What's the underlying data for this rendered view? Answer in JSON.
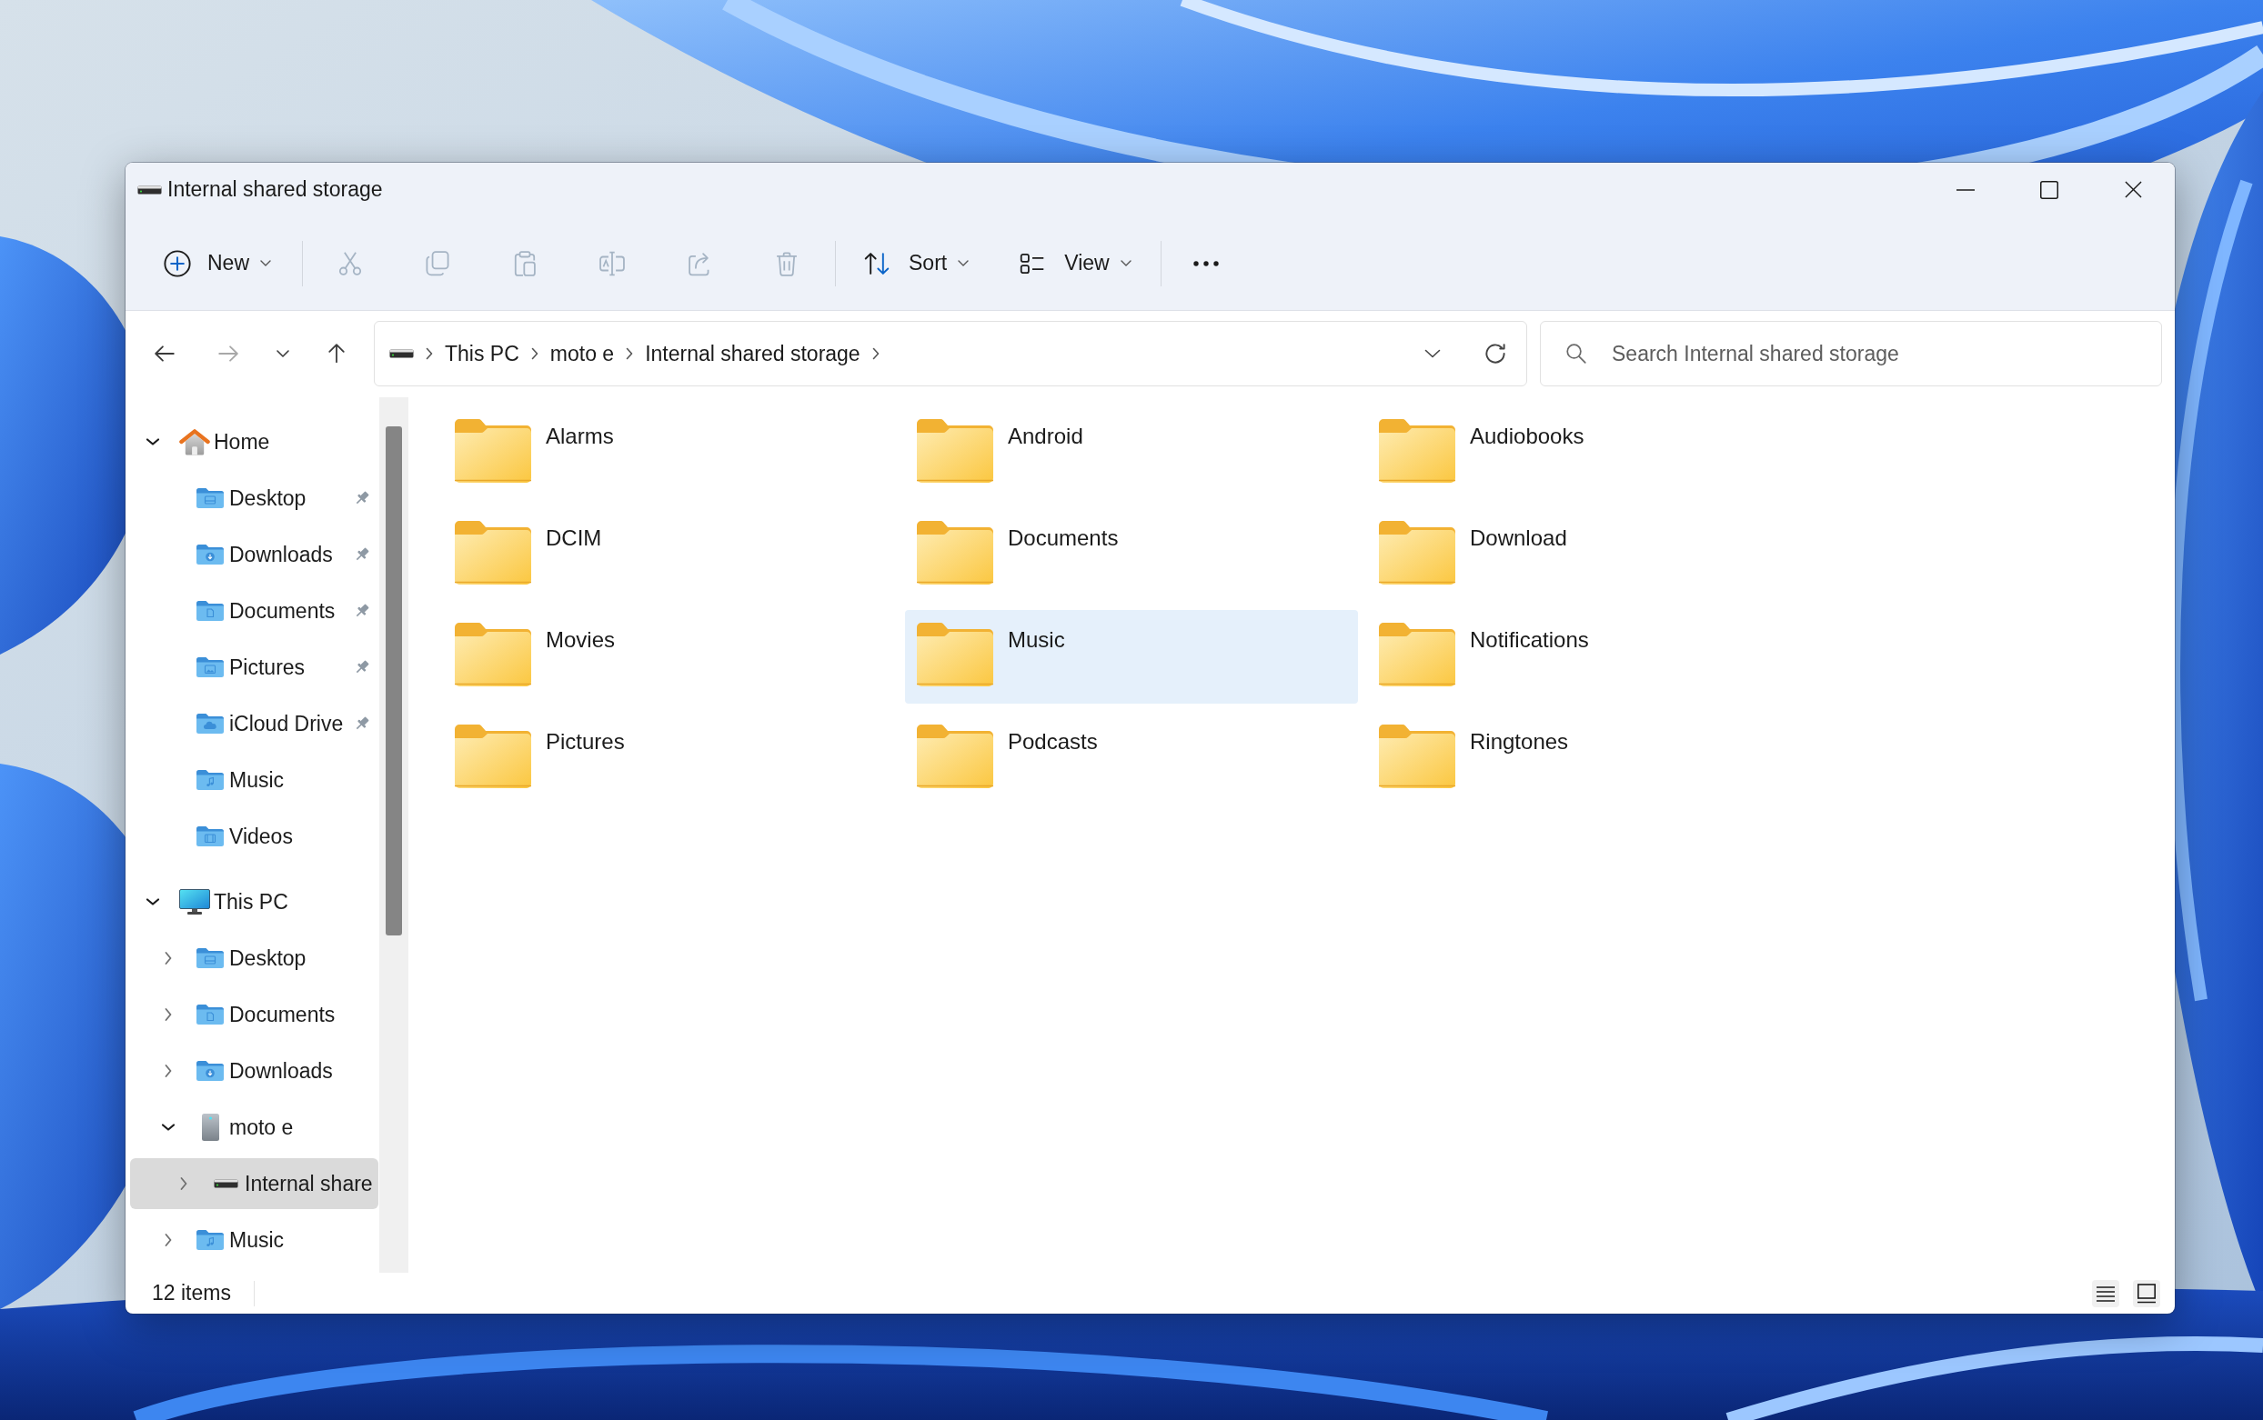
{
  "window": {
    "title": "Internal shared storage"
  },
  "toolbar": {
    "new": {
      "label": "New"
    },
    "actions": [
      {
        "disabled": true
      },
      {
        "disabled": true
      },
      {
        "disabled": true
      },
      {
        "disabled": true
      },
      {
        "disabled": true
      },
      {
        "disabled": true
      }
    ],
    "sort": {
      "label": "Sort"
    },
    "view": {
      "label": "View"
    }
  },
  "navigation": [
    {
      "disabled": false
    },
    {
      "disabled": true
    },
    {
      "disabled": false
    },
    {
      "disabled": false
    }
  ],
  "address_bar": {
    "breadcrumbs": [
      "This PC",
      "moto e",
      "Internal shared storage"
    ]
  },
  "search": {
    "placeholder": "Search Internal shared storage"
  },
  "sidebar": {
    "items": [
      {
        "label": "Home",
        "kind": "home",
        "expanded": true,
        "selected": false,
        "children": [
          {
            "label": "Desktop",
            "kind": "desktop",
            "pinned": true,
            "selected": false
          },
          {
            "label": "Downloads",
            "kind": "downloads",
            "pinned": true,
            "selected": false
          },
          {
            "label": "Documents",
            "kind": "documents",
            "pinned": true,
            "selected": false
          },
          {
            "label": "Pictures",
            "kind": "pictures",
            "pinned": true,
            "selected": false
          },
          {
            "label": "iCloud Drive",
            "kind": "cloud",
            "pinned": true,
            "selected": false
          },
          {
            "label": "Music",
            "kind": "music",
            "pinned": false,
            "selected": false
          },
          {
            "label": "Videos",
            "kind": "videos",
            "pinned": false,
            "selected": false
          }
        ]
      },
      {
        "label": "This PC",
        "kind": "pc",
        "expanded": true,
        "selected": false,
        "children": [
          {
            "label": "Desktop",
            "kind": "desktop",
            "expanded": false,
            "selected": false
          },
          {
            "label": "Documents",
            "kind": "documents",
            "expanded": false,
            "selected": false
          },
          {
            "label": "Downloads",
            "kind": "downloads",
            "expanded": false,
            "selected": false
          },
          {
            "label": "moto e",
            "kind": "device",
            "expanded": true,
            "selected": false,
            "children": [
              {
                "label": "Internal share",
                "kind": "drive",
                "expanded": false,
                "selected": true
              }
            ]
          },
          {
            "label": "Music",
            "kind": "music",
            "expanded": false,
            "selected": false
          }
        ]
      }
    ]
  },
  "folders": [
    {
      "name": "Alarms",
      "selected": false
    },
    {
      "name": "Android",
      "selected": false
    },
    {
      "name": "Audiobooks",
      "selected": false
    },
    {
      "name": "DCIM",
      "selected": false
    },
    {
      "name": "Documents",
      "selected": false
    },
    {
      "name": "Download",
      "selected": false
    },
    {
      "name": "Movies",
      "selected": false
    },
    {
      "name": "Music",
      "selected": true
    },
    {
      "name": "Notifications",
      "selected": false
    },
    {
      "name": "Pictures",
      "selected": false
    },
    {
      "name": "Podcasts",
      "selected": false
    },
    {
      "name": "Ringtones",
      "selected": false
    }
  ],
  "status_bar": {
    "item_count": "12 items"
  }
}
